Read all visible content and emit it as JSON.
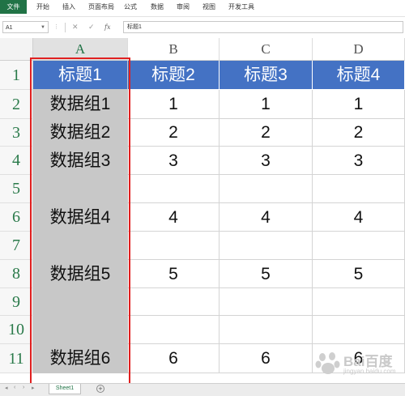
{
  "ribbon": {
    "file_tab": "文件",
    "menu": [
      "开始",
      "插入",
      "页面布局",
      "公式",
      "数据",
      "审阅",
      "视图",
      "开发工具"
    ]
  },
  "formula_bar": {
    "name_box": "A1",
    "content": "标题1"
  },
  "grid": {
    "columns": [
      "A",
      "B",
      "C",
      "D"
    ],
    "rows": [
      "1",
      "2",
      "3",
      "4",
      "5",
      "6",
      "7",
      "8",
      "9",
      "10",
      "11"
    ],
    "header_row": [
      "标题1",
      "标题2",
      "标题3",
      "标题4"
    ],
    "data_rows": [
      [
        "数据组1",
        "1",
        "1",
        "1"
      ],
      [
        "数据组2",
        "2",
        "2",
        "2"
      ],
      [
        "数据组3",
        "3",
        "3",
        "3"
      ],
      [
        "",
        "",
        "",
        ""
      ],
      [
        "数据组4",
        "4",
        "4",
        "4"
      ],
      [
        "",
        "",
        "",
        ""
      ],
      [
        "数据组5",
        "5",
        "5",
        "5"
      ],
      [
        "",
        "",
        "",
        ""
      ],
      [
        "",
        "",
        "",
        ""
      ],
      [
        "数据组6",
        "6",
        "6",
        "6"
      ]
    ]
  },
  "sheet_tabs": {
    "active": "Sheet1",
    "add_label": "+"
  },
  "watermark": {
    "brand": "Bai百度",
    "sub": "jingyan.baidu.com"
  },
  "colors": {
    "header_fill": "#4472c4",
    "column_a_fill": "#c8c8c8",
    "selection_outline": "#e02020",
    "ribbon_accent": "#217346"
  }
}
